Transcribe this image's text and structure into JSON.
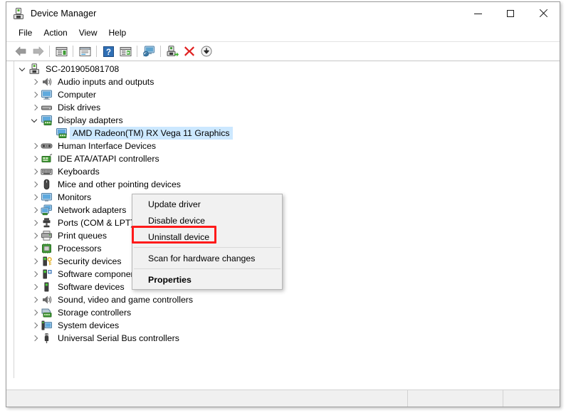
{
  "window": {
    "title": "Device Manager",
    "icon": "device-manager-icon",
    "controls": {
      "minimize": "minimize-button",
      "maximize": "maximize-button",
      "close": "close-button"
    }
  },
  "menubar": {
    "items": [
      {
        "label": "File"
      },
      {
        "label": "Action"
      },
      {
        "label": "View"
      },
      {
        "label": "Help"
      }
    ]
  },
  "toolbar": {
    "buttons": [
      {
        "name": "back-icon",
        "tooltip": "Back"
      },
      {
        "name": "forward-icon",
        "tooltip": "Forward"
      },
      {
        "name": "show-hide-console-tree-icon",
        "tooltip": "Show/Hide Console Tree"
      },
      {
        "name": "properties-icon",
        "tooltip": "Properties"
      },
      {
        "name": "help-icon",
        "tooltip": "Help"
      },
      {
        "name": "update-driver-icon",
        "tooltip": "Update Driver Software"
      },
      {
        "name": "scan-hardware-changes-icon",
        "tooltip": "Scan for hardware changes"
      },
      {
        "name": "enable-device-icon",
        "tooltip": "Enable device"
      },
      {
        "name": "uninstall-device-icon",
        "tooltip": "Uninstall device"
      },
      {
        "name": "disable-device-icon",
        "tooltip": "Disable device"
      }
    ]
  },
  "tree": {
    "root": {
      "label": "SC-201905081708",
      "icon": "computer-root-icon",
      "depth": 0,
      "expanded": true,
      "selected": false
    },
    "items": [
      {
        "label": "Audio inputs and outputs",
        "icon": "speaker-icon",
        "depth": 1,
        "expanded": false,
        "selected": false
      },
      {
        "label": "Computer",
        "icon": "monitor-icon",
        "depth": 1,
        "expanded": false,
        "selected": false
      },
      {
        "label": "Disk drives",
        "icon": "disk-drive-icon",
        "depth": 1,
        "expanded": false,
        "selected": false
      },
      {
        "label": "Display adapters",
        "icon": "display-adapter-icon",
        "depth": 1,
        "expanded": true,
        "selected": false
      },
      {
        "label": "AMD Radeon(TM) RX Vega 11 Graphics",
        "icon": "display-adapter-icon",
        "depth": 2,
        "expanded": null,
        "selected": true
      },
      {
        "label": "Human Interface Devices",
        "icon": "hid-icon",
        "depth": 1,
        "expanded": false,
        "selected": false
      },
      {
        "label": "IDE ATA/ATAPI controllers",
        "icon": "ide-controller-icon",
        "depth": 1,
        "expanded": false,
        "selected": false
      },
      {
        "label": "Keyboards",
        "icon": "keyboard-icon",
        "depth": 1,
        "expanded": false,
        "selected": false
      },
      {
        "label": "Mice and other pointing devices",
        "icon": "mouse-icon",
        "depth": 1,
        "expanded": false,
        "selected": false
      },
      {
        "label": "Monitors",
        "icon": "monitor-icon",
        "depth": 1,
        "expanded": false,
        "selected": false
      },
      {
        "label": "Network adapters",
        "icon": "network-adapter-icon",
        "depth": 1,
        "expanded": false,
        "selected": false
      },
      {
        "label": "Ports (COM & LPT)",
        "icon": "port-icon",
        "depth": 1,
        "expanded": false,
        "selected": false
      },
      {
        "label": "Print queues",
        "icon": "printer-icon",
        "depth": 1,
        "expanded": false,
        "selected": false
      },
      {
        "label": "Processors",
        "icon": "processor-icon",
        "depth": 1,
        "expanded": false,
        "selected": false
      },
      {
        "label": "Security devices",
        "icon": "security-device-icon",
        "depth": 1,
        "expanded": false,
        "selected": false
      },
      {
        "label": "Software components",
        "icon": "software-component-icon",
        "depth": 1,
        "expanded": false,
        "selected": false
      },
      {
        "label": "Software devices",
        "icon": "software-device-icon",
        "depth": 1,
        "expanded": false,
        "selected": false
      },
      {
        "label": "Sound, video and game controllers",
        "icon": "speaker-icon",
        "depth": 1,
        "expanded": false,
        "selected": false
      },
      {
        "label": "Storage controllers",
        "icon": "storage-controller-icon",
        "depth": 1,
        "expanded": false,
        "selected": false
      },
      {
        "label": "System devices",
        "icon": "system-device-icon",
        "depth": 1,
        "expanded": false,
        "selected": false
      },
      {
        "label": "Universal Serial Bus controllers",
        "icon": "usb-icon",
        "depth": 1,
        "expanded": false,
        "selected": false
      }
    ]
  },
  "context_menu": {
    "items": [
      {
        "label": "Update driver",
        "type": "item",
        "bold": false,
        "highlighted": false
      },
      {
        "label": "Disable device",
        "type": "item",
        "bold": false,
        "highlighted": false
      },
      {
        "label": "Uninstall device",
        "type": "item",
        "bold": false,
        "highlighted": true
      },
      {
        "label": "",
        "type": "separator",
        "bold": false,
        "highlighted": false
      },
      {
        "label": "Scan for hardware changes",
        "type": "item",
        "bold": false,
        "highlighted": false
      },
      {
        "label": "",
        "type": "separator",
        "bold": false,
        "highlighted": false
      },
      {
        "label": "Properties",
        "type": "item",
        "bold": true,
        "highlighted": false
      }
    ],
    "highlight_color": "#ff1a1a"
  },
  "statusbar": {
    "panes": [
      "",
      "",
      ""
    ]
  },
  "colors": {
    "selection": "#cce8ff",
    "menu_bg": "#f1f1f1",
    "window_bg": "#ffffff",
    "highlight_red": "#ff1a1a"
  }
}
